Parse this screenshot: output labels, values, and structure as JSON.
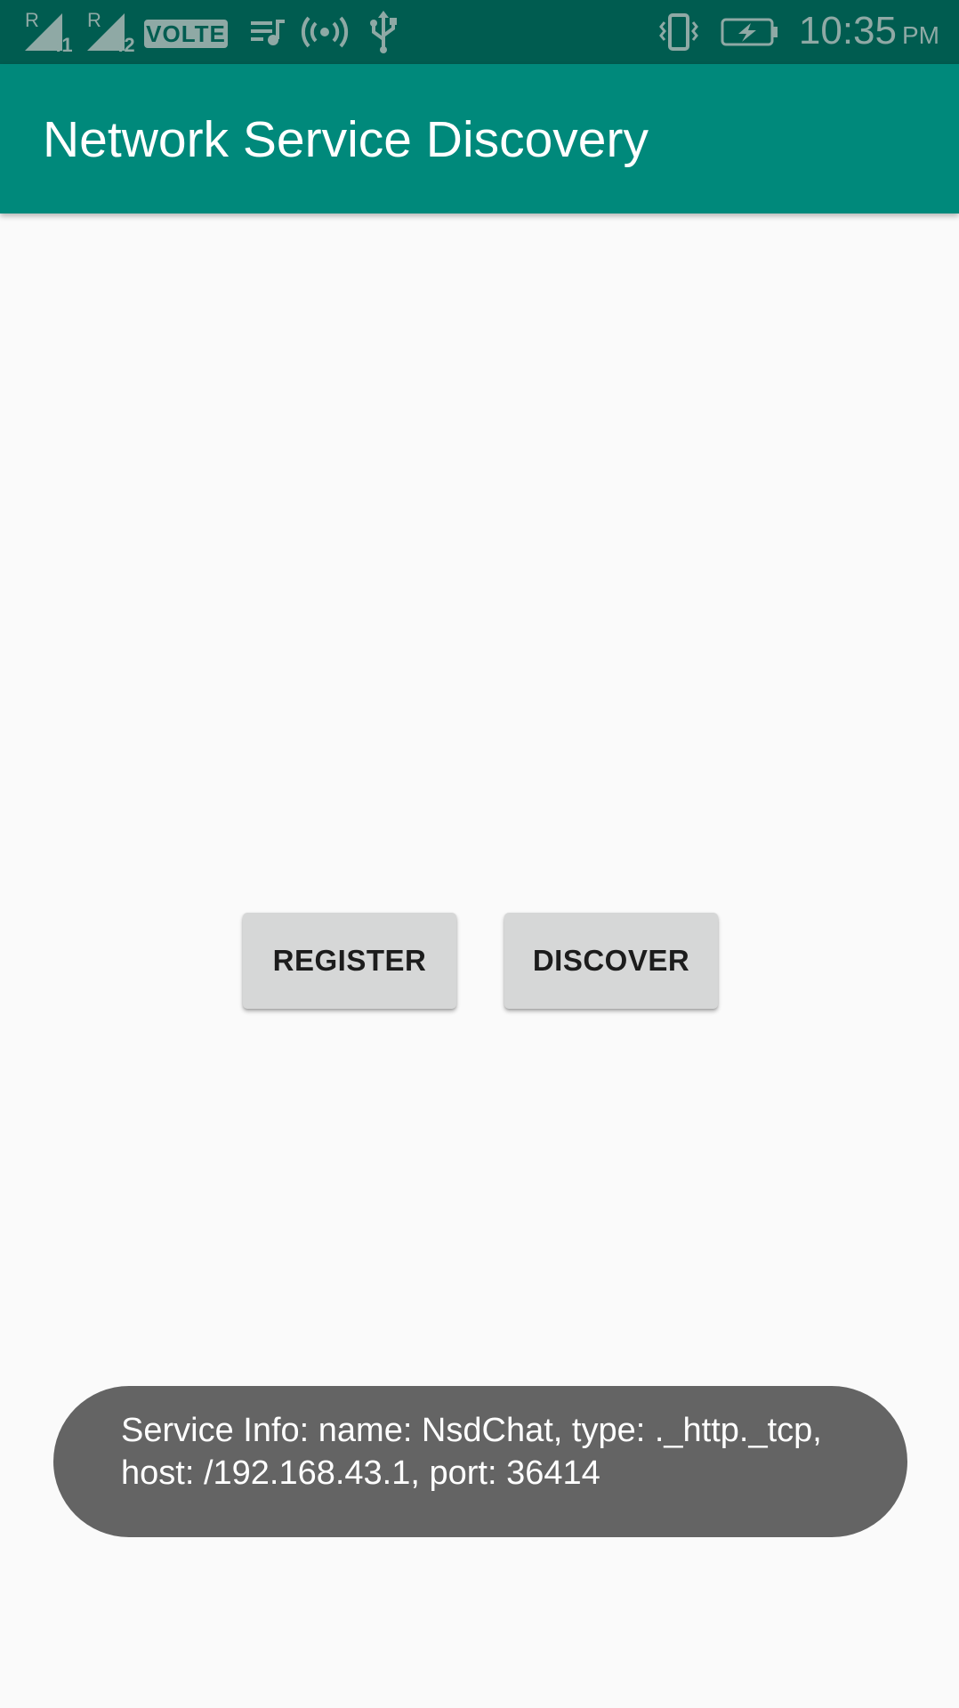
{
  "status_bar": {
    "sim1_roaming": "R",
    "sim1_slot": "!1",
    "sim2_roaming": "R",
    "sim2_slot": "!2",
    "volte_label": "VOLTE",
    "time": "10:35",
    "ampm": "PM",
    "icons": [
      "signal-sim1-icon",
      "signal-sim2-icon",
      "volte-icon",
      "media-playing-icon",
      "hotspot-icon",
      "usb-icon",
      "vibrate-icon",
      "battery-charging-icon"
    ],
    "color": "#8fa9a5",
    "background": "#005c50"
  },
  "app_bar": {
    "title": "Network Service Discovery",
    "background": "#00897b"
  },
  "buttons": {
    "register_label": "REGISTER",
    "discover_label": "DISCOVER"
  },
  "toast": {
    "line1": "Service Info: name: NsdChat, type: ._http._tcp,",
    "line2": "host: /192.168.43.1, port: 36414"
  }
}
